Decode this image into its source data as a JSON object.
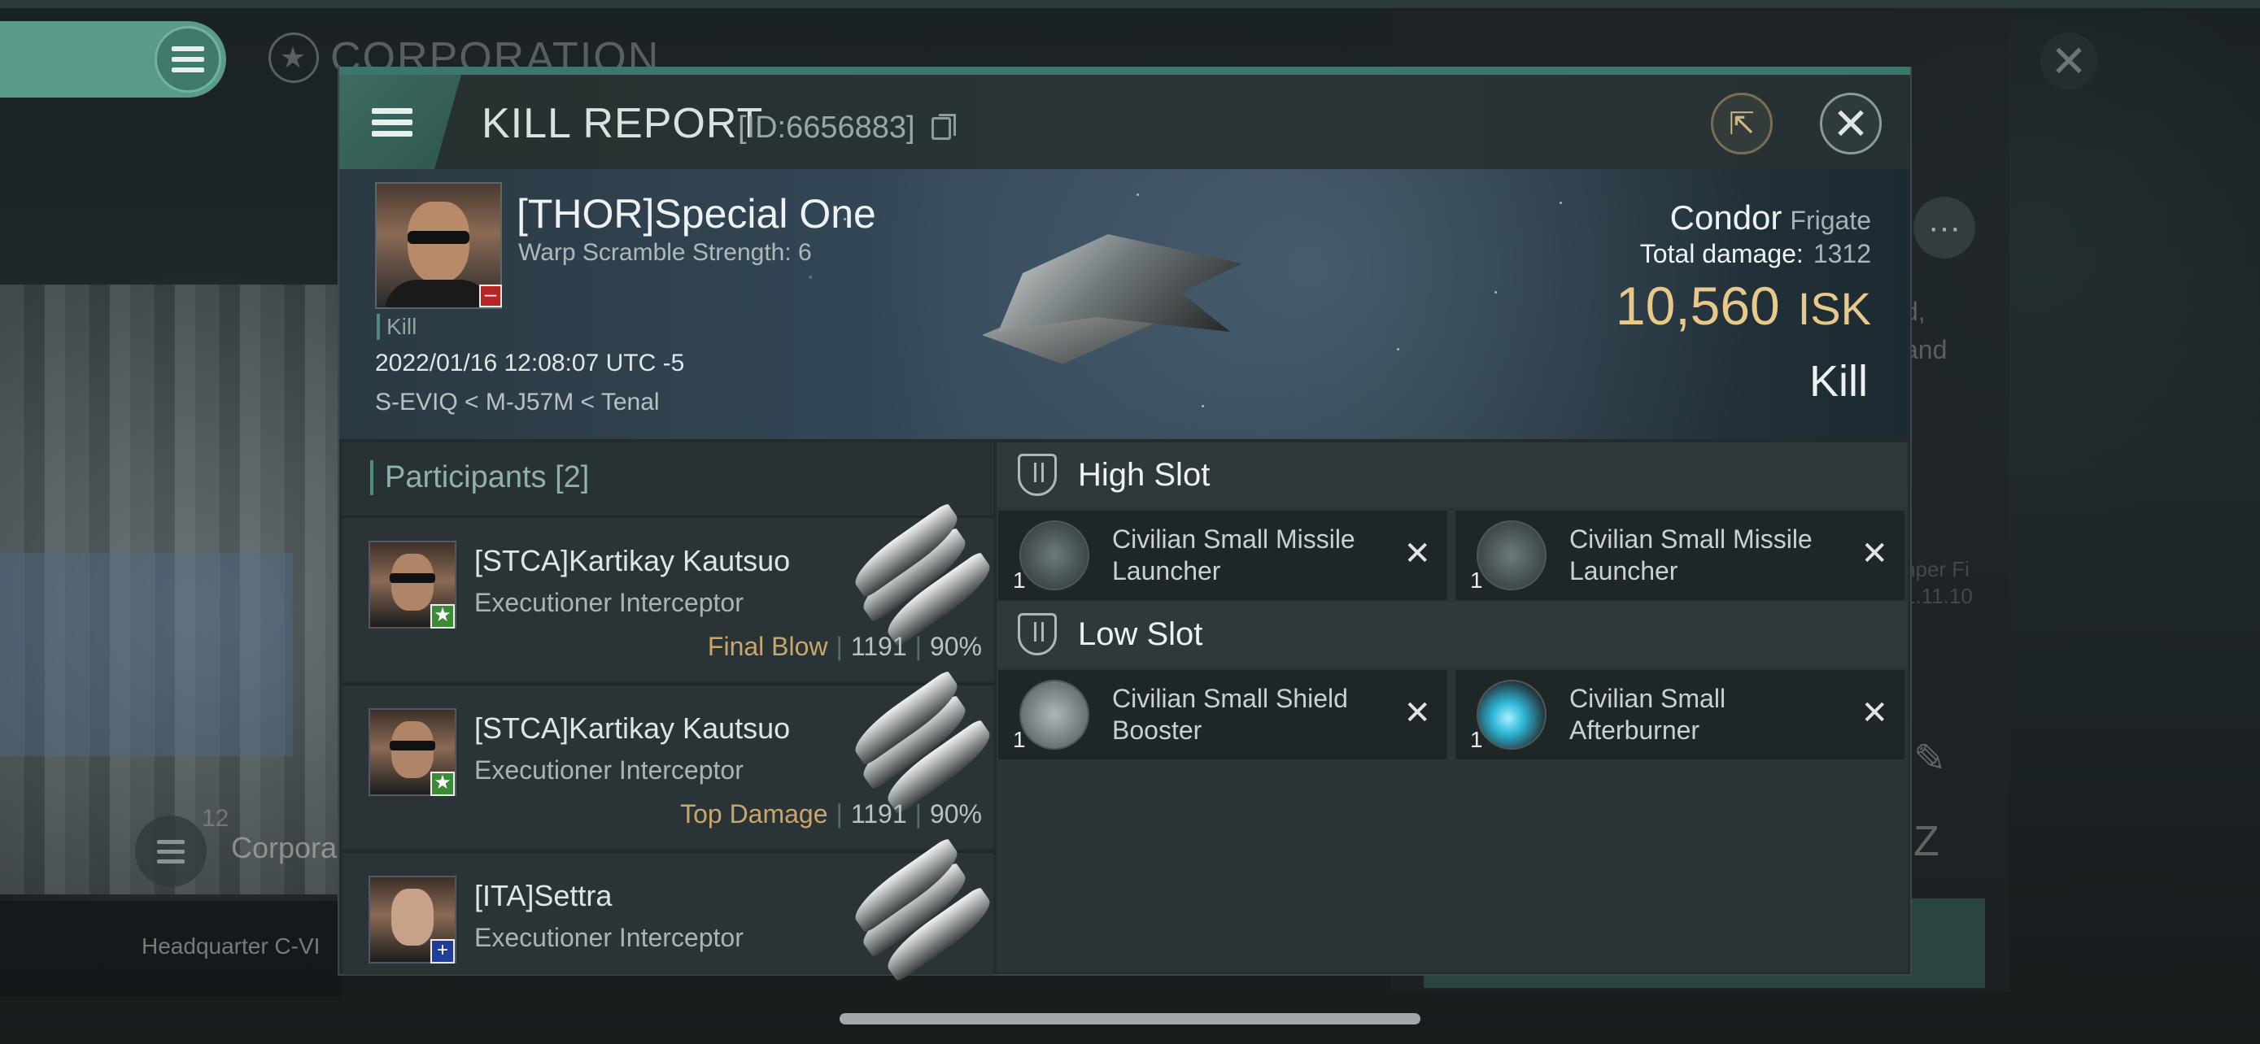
{
  "background": {
    "corporation_title": "CORPORATION",
    "corp_label": "Corpora",
    "corp_count": "12",
    "headquarter_text": "Headquarter C-VI",
    "right_text_1": "d,",
    "right_text_2": "and",
    "right_text_3": "nper Fi",
    "right_text_4": "1.11.10"
  },
  "modal": {
    "title": "KILL REPORT",
    "report_id": "[ID:6656883]",
    "victim": {
      "name": "[THOR]Special One",
      "warp_scramble": "Warp Scramble Strength: 6",
      "kill_tag": "Kill",
      "timestamp": "2022/01/16 12:08:07 UTC -5",
      "location": "S-EVIQ < M-J57M < Tenal"
    },
    "ship": {
      "name": "Condor",
      "class": "Frigate",
      "damage_label": "Total damage:",
      "damage_value": "1312",
      "isk_value": "10,560",
      "isk_unit": "ISK",
      "result": "Kill"
    },
    "participants": {
      "header": "Participants [2]",
      "rows": [
        {
          "name": "[STCA]Kartikay Kautsuo",
          "ship": "Executioner Interceptor",
          "role": "Final Blow",
          "damage": "1191",
          "percent": "90%"
        },
        {
          "name": "[STCA]Kartikay Kautsuo",
          "ship": "Executioner Interceptor",
          "role": "Top Damage",
          "damage": "1191",
          "percent": "90%"
        },
        {
          "name": "[ITA]Settra",
          "ship": "Executioner Interceptor"
        }
      ]
    },
    "slots": {
      "high": {
        "title": "High Slot",
        "modules": [
          {
            "name": "Civilian Small Missile Launcher",
            "qty": "1"
          },
          {
            "name": "Civilian Small Missile Launcher",
            "qty": "1"
          }
        ]
      },
      "low": {
        "title": "Low Slot",
        "modules": [
          {
            "name": "Civilian Small Shield Booster",
            "qty": "1"
          },
          {
            "name": "Civilian Small Afterburner",
            "qty": "1"
          }
        ]
      }
    }
  },
  "colors": {
    "accent": "#3d766c",
    "isk": "#e8c98a",
    "role": "#c8a86a"
  }
}
